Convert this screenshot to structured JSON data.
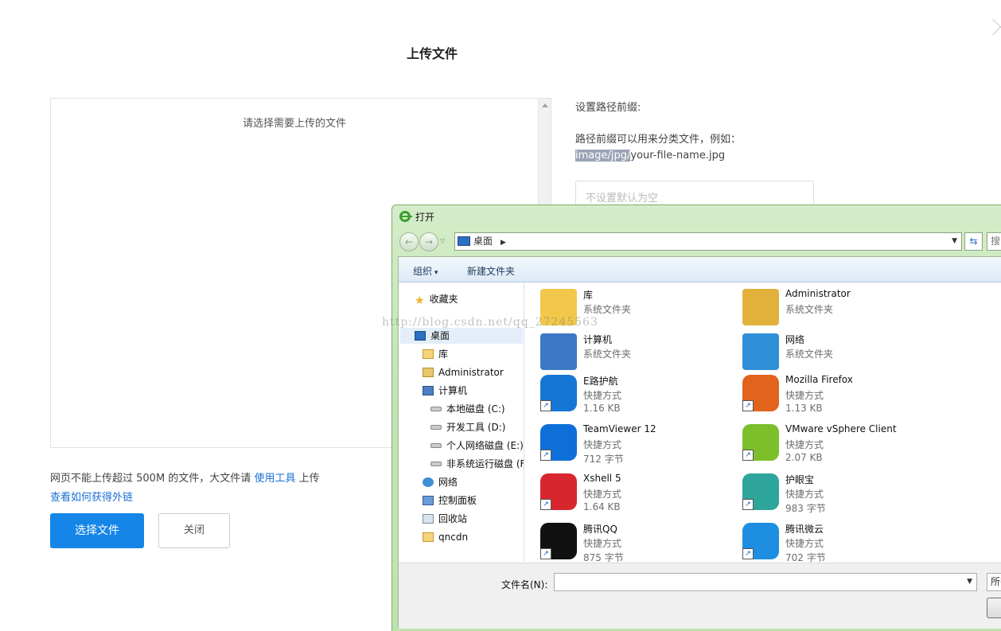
{
  "upload": {
    "title": "上传文件",
    "drop_hint": "请选择需要上传的文件",
    "prefix_label": "设置路径前缀:",
    "prefix_desc": "路径前缀可以用来分类文件，例如：",
    "prefix_example_highlight": "image/jpg/",
    "prefix_example_rest": "your-file-name.jpg",
    "prefix_placeholder": "不设置默认为空",
    "limit_text_before": "网页不能上传超过 500M 的文件，大文件请 ",
    "limit_link": "使用工具",
    "limit_text_after": " 上传",
    "external_link": "查看如何获得外链",
    "choose_button": "选择文件",
    "close_button": "关闭"
  },
  "dialog": {
    "title": "打开",
    "address": "桌面",
    "search_partial": "搜",
    "toolbar": {
      "organize": "组织",
      "new_folder": "新建文件夹"
    },
    "nav_items": [
      {
        "label": "收藏夹",
        "icon": "star-icon"
      },
      {
        "label": "桌面",
        "icon": "desktop-icon"
      },
      {
        "label": "库",
        "icon": "library-icon"
      },
      {
        "label": "Administrator",
        "icon": "user-folder-icon"
      },
      {
        "label": "计算机",
        "icon": "computer-icon"
      },
      {
        "label": "本地磁盘 (C:)",
        "icon": "drive-icon"
      },
      {
        "label": "开发工具 (D:)",
        "icon": "drive-icon"
      },
      {
        "label": "个人网络磁盘 (E:)",
        "icon": "drive-icon"
      },
      {
        "label": "非系统运行磁盘 (F",
        "icon": "drive-icon"
      },
      {
        "label": "网络",
        "icon": "network-icon"
      },
      {
        "label": "控制面板",
        "icon": "control-panel-icon"
      },
      {
        "label": "回收站",
        "icon": "recycle-bin-icon"
      },
      {
        "label": "qncdn",
        "icon": "folder-icon"
      }
    ],
    "files": [
      {
        "name": "库",
        "type": "系统文件夹",
        "size": "",
        "icon": "library-icon",
        "color": "#f2c84b"
      },
      {
        "name": "Administrator",
        "type": "系统文件夹",
        "size": "",
        "icon": "user-folder-icon",
        "color": "#e2b13c"
      },
      {
        "name": "计算机",
        "type": "系统文件夹",
        "size": "",
        "icon": "computer-icon",
        "color": "#3c78c4"
      },
      {
        "name": "网络",
        "type": "系统文件夹",
        "size": "",
        "icon": "network-icon",
        "color": "#2f8fd8"
      },
      {
        "name": "E路护航",
        "type": "快捷方式",
        "size": "1.16 KB",
        "icon": "e-guard-icon",
        "color": "#1676d6"
      },
      {
        "name": "Mozilla Firefox",
        "type": "快捷方式",
        "size": "1.13 KB",
        "icon": "firefox-icon",
        "color": "#e2631c"
      },
      {
        "name": "TeamViewer 12",
        "type": "快捷方式",
        "size": "712 字节",
        "icon": "teamviewer-icon",
        "color": "#0e6fd8"
      },
      {
        "name": "VMware vSphere Client",
        "type": "快捷方式",
        "size": "2.07 KB",
        "icon": "vmware-icon",
        "color": "#7cbf2a"
      },
      {
        "name": "Xshell 5",
        "type": "快捷方式",
        "size": "1.64 KB",
        "icon": "xshell-icon",
        "color": "#d8262f"
      },
      {
        "name": "护眼宝",
        "type": "快捷方式",
        "size": "983 字节",
        "icon": "eye-care-icon",
        "color": "#2ea59a"
      },
      {
        "name": "腾讯QQ",
        "type": "快捷方式",
        "size": "875 字节",
        "icon": "qq-icon",
        "color": "#111111"
      },
      {
        "name": "腾讯微云",
        "type": "快捷方式",
        "size": "702 字节",
        "icon": "weiyun-icon",
        "color": "#1e8fe0"
      }
    ],
    "filename_label": "文件名(N):",
    "filetype_partial": "所有"
  },
  "watermark": "http://blog.csdn.net/qq_27245563"
}
